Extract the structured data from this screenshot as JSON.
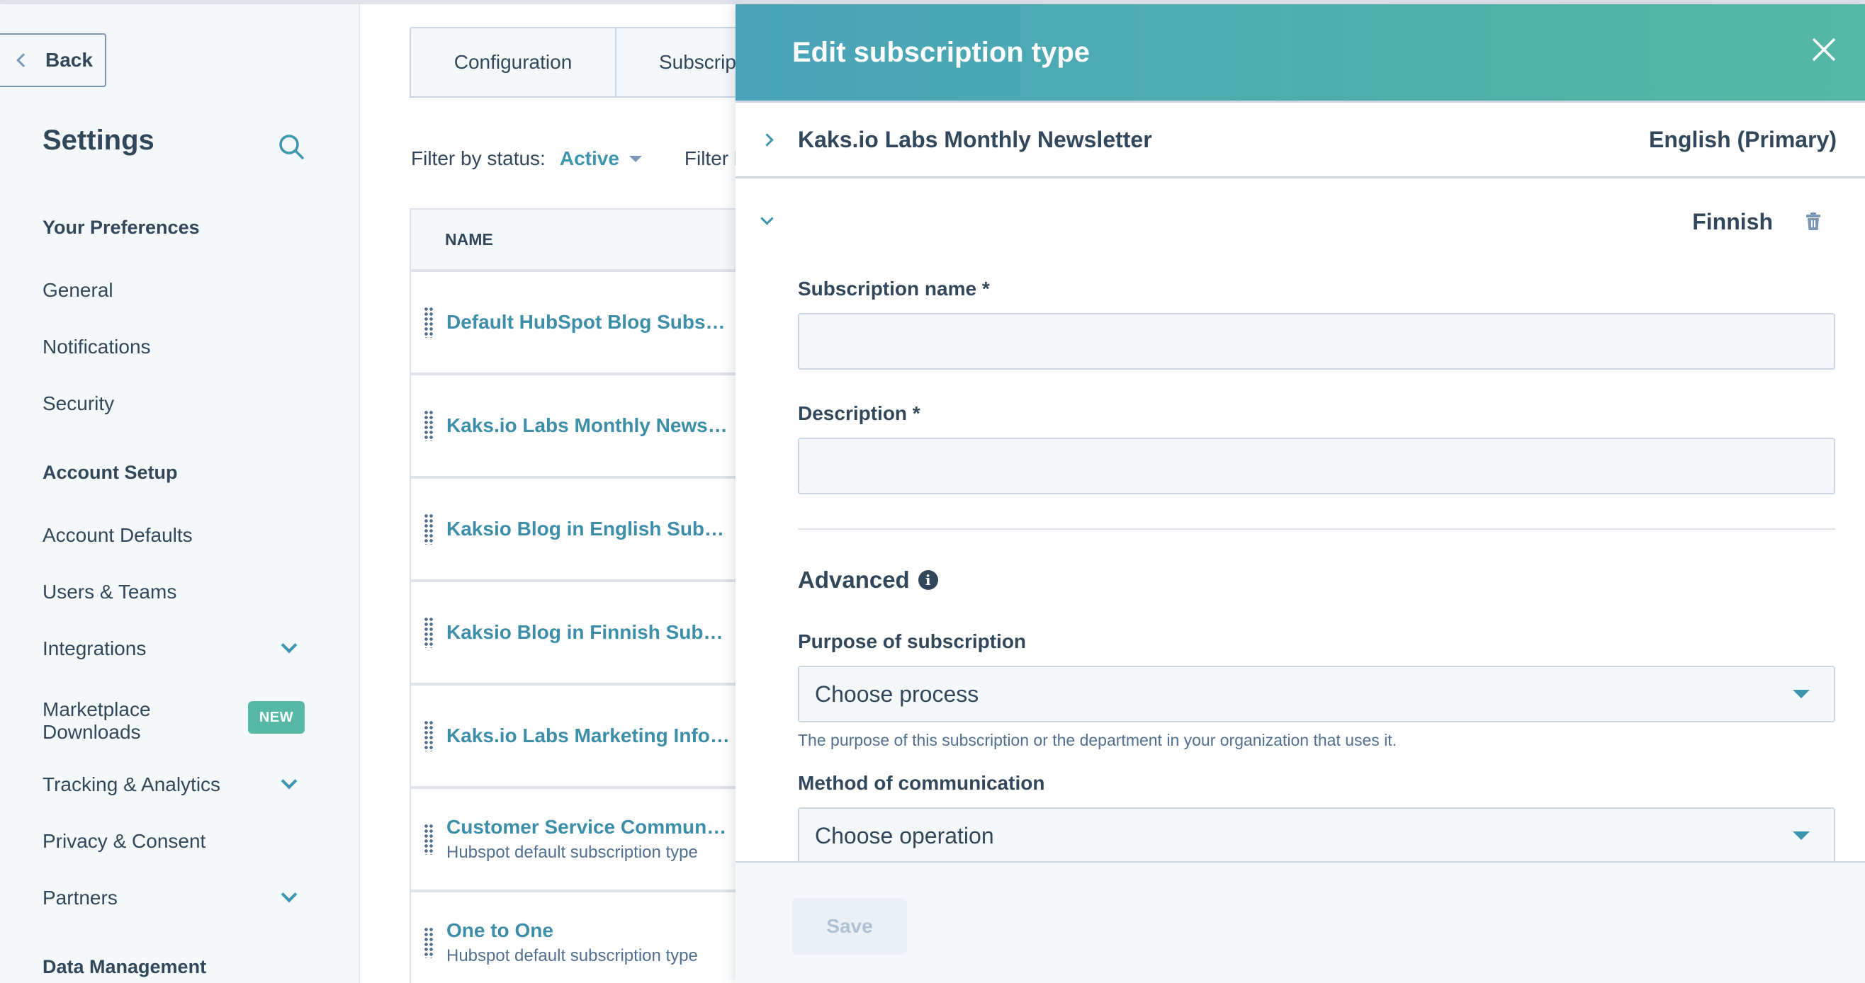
{
  "sidebar": {
    "back_label": "Back",
    "title": "Settings",
    "sections": [
      {
        "label": "Your Preferences",
        "items": [
          {
            "label": "General"
          },
          {
            "label": "Notifications"
          },
          {
            "label": "Security"
          }
        ]
      },
      {
        "label": "Account Setup",
        "items": [
          {
            "label": "Account Defaults"
          },
          {
            "label": "Users & Teams"
          },
          {
            "label": "Integrations",
            "expandable": true
          },
          {
            "label": "Marketplace Downloads",
            "badge": "NEW"
          },
          {
            "label": "Tracking & Analytics",
            "expandable": true
          },
          {
            "label": "Privacy & Consent"
          },
          {
            "label": "Partners",
            "expandable": true
          }
        ]
      },
      {
        "label": "Data Management",
        "items": []
      }
    ]
  },
  "main": {
    "tabs": [
      {
        "label": "Configuration"
      },
      {
        "label": "Subscriptions"
      }
    ],
    "filter": {
      "status_label": "Filter by status:",
      "status_value": "Active",
      "second_label": "Filter by"
    },
    "table": {
      "header": "NAME",
      "rows": [
        {
          "name": "Default HubSpot Blog Subscription",
          "sub": ""
        },
        {
          "name": "Kaks.io Labs Monthly Newsletter",
          "sub": ""
        },
        {
          "name": "Kaksio Blog in English Subscription",
          "sub": ""
        },
        {
          "name": "Kaksio Blog in Finnish Subscription",
          "sub": ""
        },
        {
          "name": "Kaks.io Labs Marketing Information",
          "sub": ""
        },
        {
          "name": "Customer Service Communication",
          "sub": "Hubspot default subscription type"
        },
        {
          "name": "One to One",
          "sub": "Hubspot default subscription type"
        }
      ]
    }
  },
  "panel": {
    "title": "Edit subscription type",
    "primary_row": {
      "name": "Kaks.io Labs Monthly Newsletter",
      "language": "English (Primary)"
    },
    "translation_row": {
      "language": "Finnish"
    },
    "form": {
      "subscription_name_label": "Subscription name *",
      "subscription_name_value": "",
      "description_label": "Description *",
      "description_value": "",
      "advanced_label": "Advanced",
      "purpose_label": "Purpose of subscription",
      "purpose_value": "Choose process",
      "purpose_help": "The purpose of this subscription or the department in your organization that uses it.",
      "method_label": "Method of communication",
      "method_value": "Choose operation"
    },
    "save_label": "Save"
  },
  "colors": {
    "accent": "#3d95ae",
    "header_gradient_start": "#4aa3b9",
    "header_gradient_end": "#55b8a5",
    "badge_new": "#57b9a5",
    "text_primary": "#33475b"
  }
}
